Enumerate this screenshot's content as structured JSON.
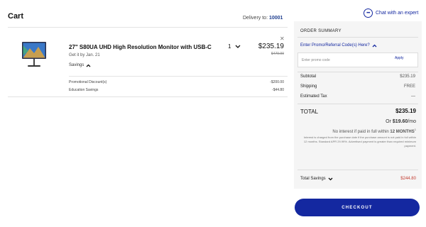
{
  "page": {
    "title": "Cart"
  },
  "delivery": {
    "label": "Delivery to:",
    "zip": "10001"
  },
  "chat": {
    "label": "Chat with an expert",
    "icon": "chat-bubble-icon"
  },
  "product": {
    "name": "27\" S80UA UHD High Resolution Monitor with USB-C",
    "delivery_text": "Get it by Jan. 21",
    "savings_label": "Savings",
    "quantity": "1",
    "price": "$235.19",
    "original_price": "$479.99",
    "discounts": [
      {
        "label": "Promotional Discount(s)",
        "value": "-$200.00"
      },
      {
        "label": "Education Savings",
        "value": "-$44.80"
      }
    ]
  },
  "summary": {
    "heading": "ORDER SUMMARY",
    "promo_link": "Enter Promo/Referral Code(s) Here?",
    "promo_placeholder": "Enter promo code",
    "apply_label": "Apply",
    "rows": [
      {
        "label": "Subtotal",
        "value": "$235.19"
      },
      {
        "label": "Shipping",
        "value": "FREE"
      },
      {
        "label": "Estimated Tax",
        "value": "—"
      }
    ],
    "total_label": "TOTAL",
    "total_value": "$235.19",
    "monthly_prefix": "Or ",
    "monthly_amount": "$19.60",
    "monthly_suffix": "/mo",
    "interest_prefix": "No interest if paid in full within ",
    "interest_months": "12 MONTHS",
    "interest_sup": "1",
    "fine_print": "Interest is charged from the purchase date if the purchase amount is not paid in full within 12 months. Standard APR 29.99%. Advertised payment is greater than required minimum payment.",
    "total_savings_label": "Total Savings",
    "total_savings_value": "$244.80"
  },
  "checkout_label": "CHECKOUT",
  "colors": {
    "accent": "#1428a0",
    "savings": "#c23b2f",
    "panel_bg": "#f5f5f5"
  }
}
